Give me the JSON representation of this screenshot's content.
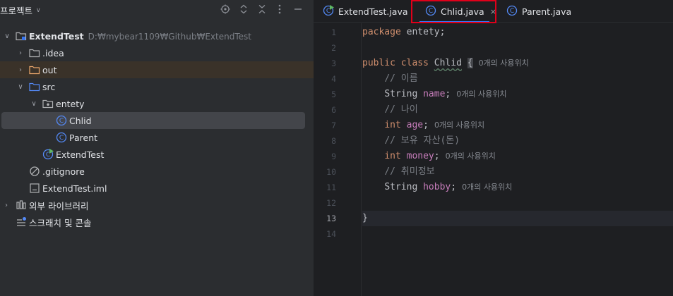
{
  "project_panel": {
    "title": "프로젝트",
    "tree": {
      "root_name": "ExtendTest",
      "root_path": "D:₩mybear1109₩Github₩ExtendTest",
      "idea": ".idea",
      "out": "out",
      "src": "src",
      "package": "entety",
      "chlid": "Chlid",
      "parent": "Parent",
      "extendtest": "ExtendTest",
      "gitignore": ".gitignore",
      "iml": "ExtendTest.iml",
      "external_libraries": "외부 라이브러리",
      "scratches": "스크래치 및 콘솔"
    }
  },
  "editor": {
    "tabs": [
      {
        "label": "ExtendTest.java"
      },
      {
        "label": "Chlid.java"
      },
      {
        "label": "Parent.java"
      }
    ],
    "close_glyph": "×",
    "usage_hint": "0개의 사용위치",
    "line_numbers": [
      "1",
      "2",
      "3",
      "4",
      "5",
      "6",
      "7",
      "8",
      "9",
      "10",
      "11",
      "12",
      "13",
      "14"
    ],
    "code": {
      "l1_kw": "package",
      "l1_rest": " entety;",
      "l3_kw1": "public",
      "l3_kw2": "class",
      "l3_cls": "Chlid",
      "l3_brace": "{",
      "l4": "// 이름",
      "l5_type": "String",
      "l5_field": "name",
      "l6": "// 나이",
      "l7_type": "int",
      "l7_field": "age",
      "l8": "// 보유 자산(돈)",
      "l9_type": "int",
      "l9_field": "money",
      "l10": "// 취미정보",
      "l11_type": "String",
      "l11_field": "hobby",
      "l13": "}",
      "semicolon": ";"
    }
  },
  "colors": {
    "background": "#1e1f22",
    "panel": "#2b2d30",
    "keyword": "#cf8e6d",
    "field": "#c77dbb",
    "comment": "#7a7e85",
    "accent": "#3574f0",
    "highlight_box": "#e0001a"
  }
}
